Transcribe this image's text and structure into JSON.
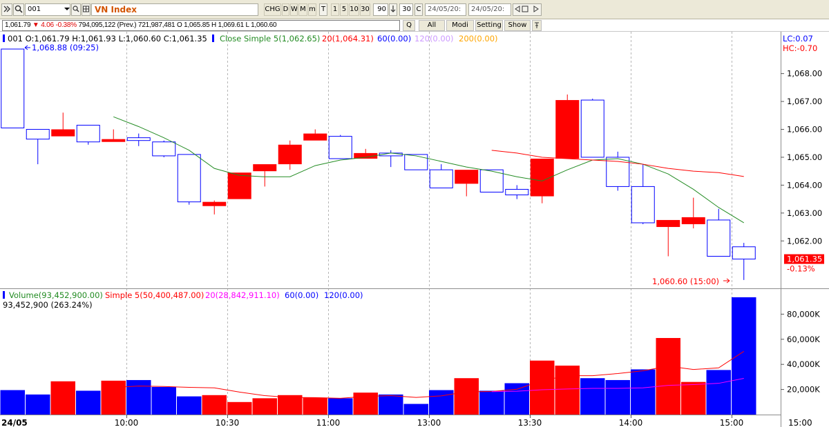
{
  "toolbar": {
    "symbol_code": "001",
    "symbol_name": "VN Index",
    "buttons": [
      "CHG",
      "D",
      "W",
      "M",
      "m",
      "T",
      "1",
      "5",
      "10",
      "30"
    ],
    "interval_value": "90",
    "count_value": "30",
    "date_from": "24/05/20:",
    "date_to": "24/05/20:"
  },
  "info": {
    "last": "1,061.79",
    "change": "▼ 4.06 -0.38%",
    "details": "794,095,122 (Prev.) 721,987,481 O 1,065.85 H 1,069.61 L 1,060.60",
    "buttons": [
      "Q",
      "All",
      "Modi",
      "Setting",
      "Show"
    ]
  },
  "legend": {
    "ohlc": "001 O:1,061.79 H:1,061.93 L:1,060.60 C:1,061.35",
    "ma5": "Close Simple 5(1,062.65)",
    "ma20": "20(1,064.31)",
    "ma60": "60(0.00)",
    "ma120": "120(0.00)",
    "ma200": "200(0.00)",
    "lc": "LC:0.07",
    "hc": "HC:-0.70",
    "high_note": "1,068.88 (09:25)",
    "low_note": "1,060.60 (15:00)",
    "last_label": "1,061.35",
    "last_pct": "-0.13%",
    "vol": "Volume(93,452,900.00)",
    "vol_ma5": "Simple 5(50,400,487.00)",
    "vol_ma20": "20(28,842,911.10)",
    "vol_ma60": "60(0.00)",
    "vol_ma120": "120(0.00)",
    "vol_sub": "93,452,900 (263.24%)"
  },
  "colors": {
    "up": "#ff0000",
    "down": "#0000ff",
    "ma5": "#228b22",
    "ma20": "#ff0000",
    "ma60": "#0000ff",
    "ma120": "#cc99ff",
    "ma200": "#ffa500",
    "vol_ma20": "#ff00ff"
  },
  "chart_data": [
    {
      "type": "candlestick",
      "y_ticks": [
        1062,
        1063,
        1064,
        1065,
        1066,
        1067,
        1068
      ],
      "y_tick_labels": [
        "1,062.00",
        "1,063.00",
        "1,064.00",
        "1,065.00",
        "1,066.00",
        "1,067.00",
        "1,068.00"
      ],
      "ylim": [
        1060.3,
        1069.5
      ],
      "x_labels": [
        "24/05",
        "10:00",
        "10:30",
        "11:00",
        "13:00",
        "13:30",
        "14:00",
        "15:00",
        "15:00"
      ],
      "candles": [
        {
          "o": 1068.88,
          "h": 1068.88,
          "l": 1066.05,
          "c": 1066.05
        },
        {
          "o": 1066.0,
          "h": 1066.0,
          "l": 1064.75,
          "c": 1065.65
        },
        {
          "o": 1065.75,
          "h": 1066.6,
          "l": 1065.75,
          "c": 1066.0
        },
        {
          "o": 1066.15,
          "h": 1066.15,
          "l": 1065.45,
          "c": 1065.55
        },
        {
          "o": 1065.55,
          "h": 1066.0,
          "l": 1065.55,
          "c": 1065.65
        },
        {
          "o": 1065.7,
          "h": 1065.85,
          "l": 1065.4,
          "c": 1065.6
        },
        {
          "o": 1065.55,
          "h": 1065.6,
          "l": 1065.0,
          "c": 1065.05
        },
        {
          "o": 1065.1,
          "h": 1065.1,
          "l": 1063.3,
          "c": 1063.4
        },
        {
          "o": 1063.25,
          "h": 1063.45,
          "l": 1062.95,
          "c": 1063.4
        },
        {
          "o": 1063.5,
          "h": 1064.45,
          "l": 1063.5,
          "c": 1064.45
        },
        {
          "o": 1064.5,
          "h": 1064.75,
          "l": 1063.95,
          "c": 1064.75
        },
        {
          "o": 1064.75,
          "h": 1065.6,
          "l": 1064.55,
          "c": 1065.45
        },
        {
          "o": 1065.6,
          "h": 1066.0,
          "l": 1065.6,
          "c": 1065.85
        },
        {
          "o": 1065.75,
          "h": 1065.8,
          "l": 1064.95,
          "c": 1064.95
        },
        {
          "o": 1064.95,
          "h": 1065.3,
          "l": 1064.95,
          "c": 1065.15
        },
        {
          "o": 1065.15,
          "h": 1065.25,
          "l": 1064.65,
          "c": 1065.05
        },
        {
          "o": 1065.1,
          "h": 1065.1,
          "l": 1064.55,
          "c": 1064.55
        },
        {
          "o": 1064.55,
          "h": 1064.75,
          "l": 1063.9,
          "c": 1063.9
        },
        {
          "o": 1064.05,
          "h": 1064.55,
          "l": 1063.6,
          "c": 1064.55
        },
        {
          "o": 1064.55,
          "h": 1064.55,
          "l": 1063.75,
          "c": 1063.75
        },
        {
          "o": 1063.85,
          "h": 1064.0,
          "l": 1063.5,
          "c": 1063.65
        },
        {
          "o": 1063.6,
          "h": 1064.95,
          "l": 1063.35,
          "c": 1064.95
        },
        {
          "o": 1064.95,
          "h": 1067.25,
          "l": 1064.95,
          "c": 1067.05
        },
        {
          "o": 1067.05,
          "h": 1067.1,
          "l": 1065.0,
          "c": 1065.0
        },
        {
          "o": 1065.0,
          "h": 1065.2,
          "l": 1063.8,
          "c": 1063.95
        },
        {
          "o": 1063.95,
          "h": 1064.75,
          "l": 1062.6,
          "c": 1062.65
        },
        {
          "o": 1062.5,
          "h": 1062.75,
          "l": 1061.45,
          "c": 1062.75
        },
        {
          "o": 1062.6,
          "h": 1063.55,
          "l": 1062.45,
          "c": 1062.85
        },
        {
          "o": 1062.75,
          "h": 1063.15,
          "l": 1061.45,
          "c": 1061.45
        },
        {
          "o": 1061.79,
          "h": 1061.93,
          "l": 1060.6,
          "c": 1061.35
        }
      ],
      "ma5": [
        null,
        null,
        null,
        null,
        1066.45,
        1066.1,
        1065.7,
        1065.25,
        1064.6,
        1064.35,
        1064.3,
        1064.3,
        1064.7,
        1064.9,
        1065.0,
        1065.15,
        1065.05,
        1064.85,
        1064.65,
        1064.5,
        1064.3,
        1064.15,
        1064.55,
        1064.9,
        1064.95,
        1064.75,
        1064.4,
        1063.85,
        1063.2,
        1062.65
      ],
      "ma20": [
        null,
        null,
        null,
        null,
        null,
        null,
        null,
        null,
        null,
        null,
        null,
        null,
        null,
        null,
        null,
        null,
        null,
        null,
        null,
        1065.25,
        1065.15,
        1065.0,
        1064.95,
        1064.9,
        1064.85,
        1064.75,
        1064.6,
        1064.5,
        1064.45,
        1064.31
      ]
    },
    {
      "type": "bar",
      "name": "Volume",
      "y_ticks": [
        20000,
        40000,
        60000,
        80000
      ],
      "y_tick_labels": [
        "20,000K",
        "40,000K",
        "60,000K",
        "80,000K"
      ],
      "ylim": [
        0,
        100000
      ],
      "values": [
        19500,
        16000,
        26500,
        19000,
        27000,
        27500,
        22000,
        14500,
        15500,
        10000,
        13000,
        15500,
        13500,
        13000,
        17500,
        16000,
        8500,
        19500,
        29000,
        19000,
        25000,
        43000,
        39000,
        29000,
        27500,
        36000,
        61000,
        26000,
        35500,
        93450
      ],
      "ma5": [
        null,
        null,
        null,
        null,
        21600,
        22700,
        22400,
        21700,
        21300,
        17900,
        15100,
        13700,
        13500,
        13000,
        14500,
        15100,
        13700,
        14900,
        18100,
        18400,
        20200,
        27100,
        31000,
        31000,
        32700,
        34900,
        38500,
        35900,
        37200,
        50400
      ],
      "ma20": [
        null,
        null,
        null,
        null,
        null,
        null,
        null,
        null,
        null,
        null,
        null,
        null,
        null,
        null,
        null,
        null,
        null,
        null,
        null,
        18300,
        18600,
        19800,
        20400,
        20900,
        20900,
        21300,
        23300,
        23900,
        24900,
        28843
      ]
    }
  ]
}
